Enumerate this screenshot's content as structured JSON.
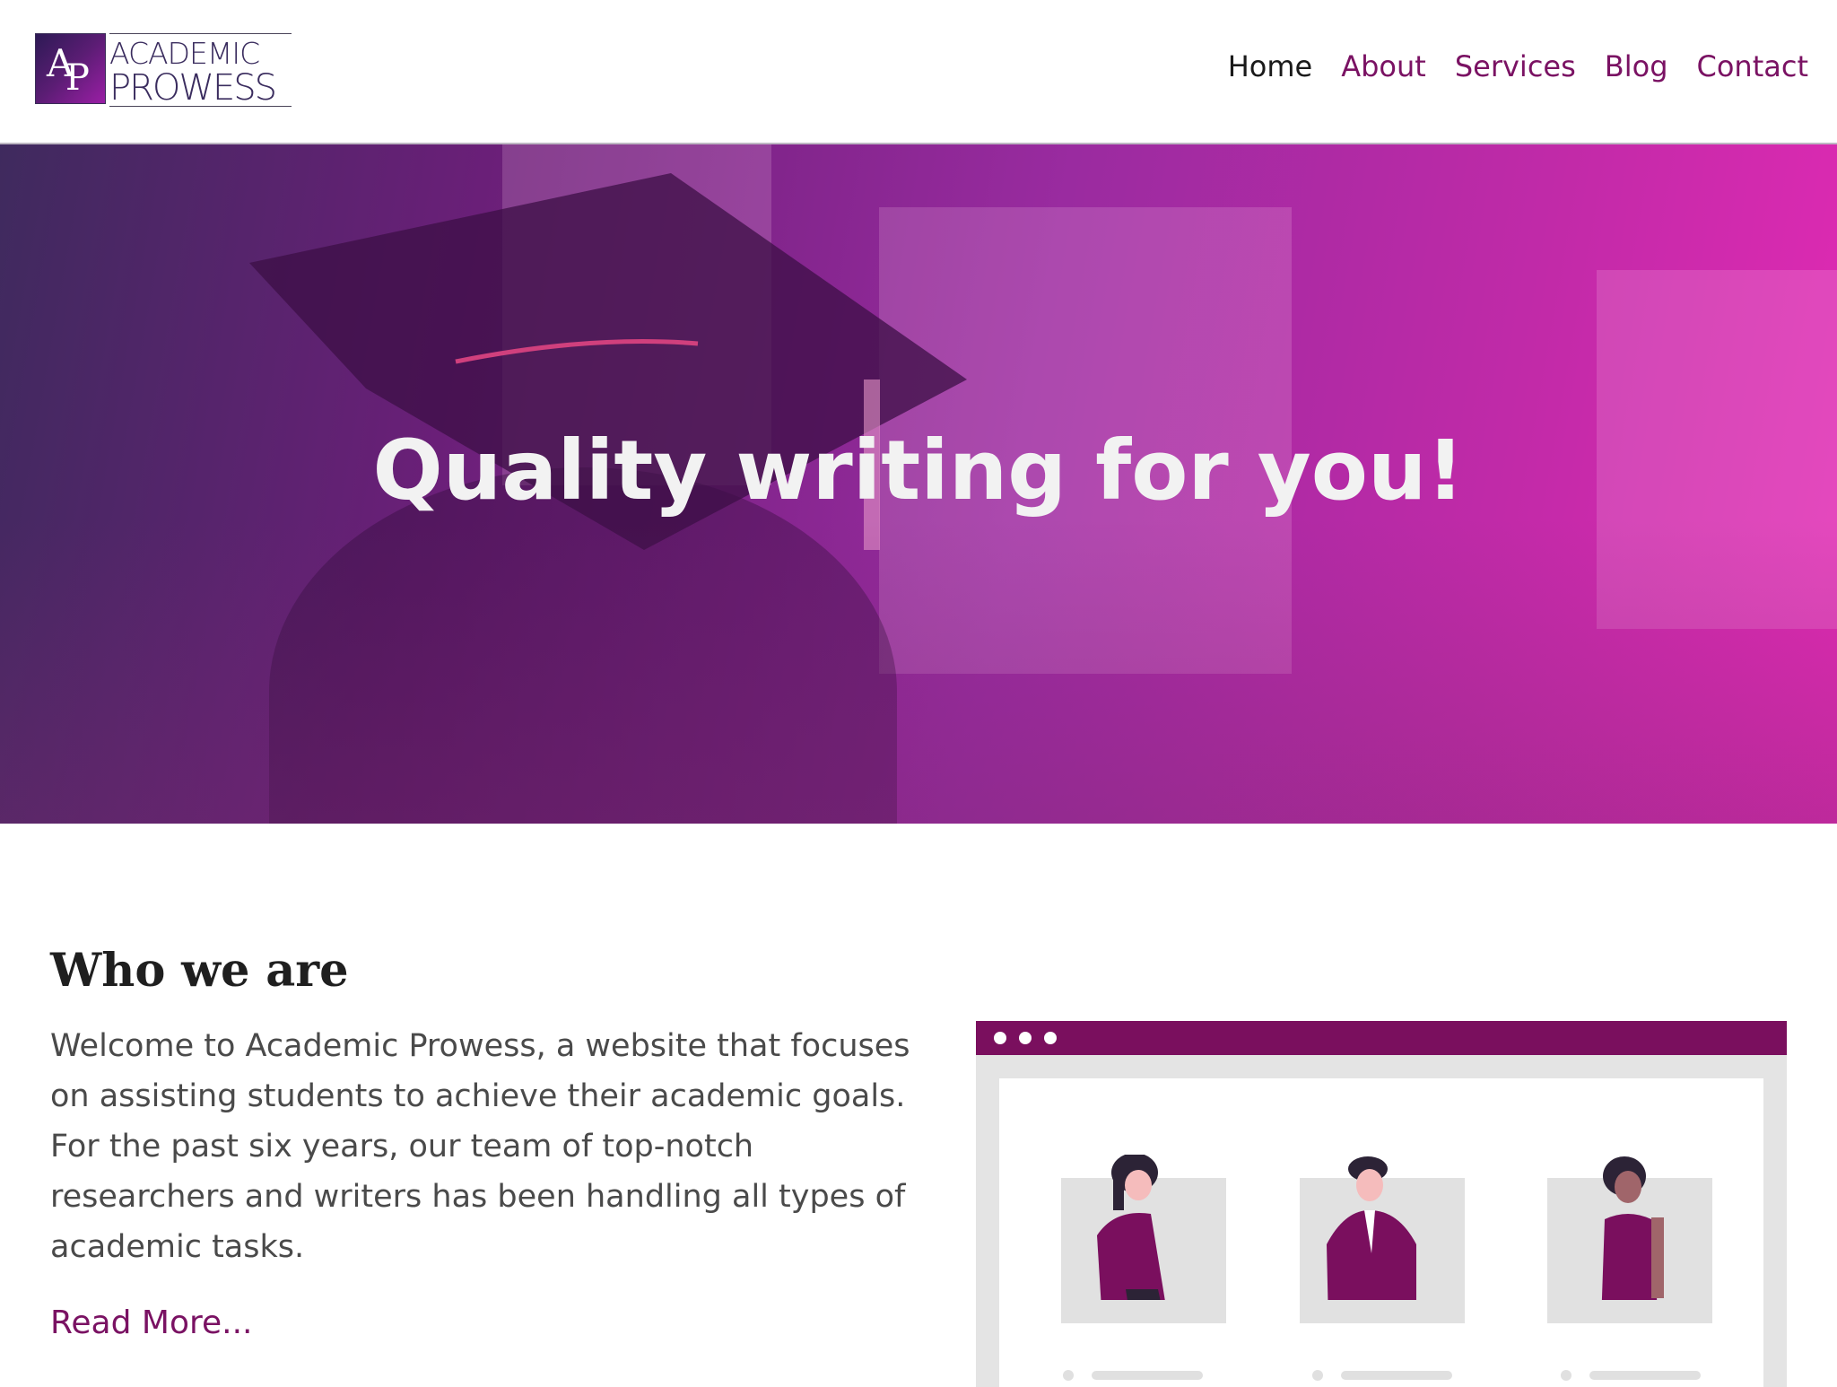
{
  "brand": {
    "mark_letter_a": "A",
    "mark_letter_p": "P",
    "line1": "ACADEMIC",
    "line2": "PROWESS"
  },
  "nav": {
    "items": [
      {
        "label": "Home",
        "active": true
      },
      {
        "label": "About",
        "active": false
      },
      {
        "label": "Services",
        "active": false
      },
      {
        "label": "Blog",
        "active": false
      },
      {
        "label": "Contact",
        "active": false
      }
    ]
  },
  "hero": {
    "title": "Quality writing for you!"
  },
  "about": {
    "heading": "Who we are",
    "lines": [
      "Welcome to Academic Prowess, a website that focuses",
      "on assisting students to achieve their academic goals.",
      "For the past six years, our team of top-notch",
      "researchers and writers has been handling all types of",
      "academic tasks."
    ],
    "read_more": "Read More..."
  },
  "colors": {
    "accent": "#7a1263",
    "browser_bar": "#7a0f5e",
    "hero_start": "#3f2a5e",
    "hero_end": "#e32ab4"
  }
}
